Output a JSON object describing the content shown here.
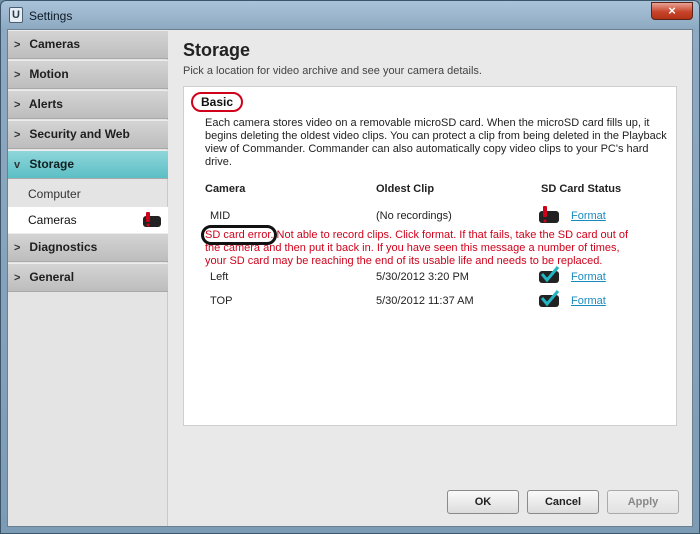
{
  "window": {
    "title": "Settings",
    "close_glyph": "×"
  },
  "sidebar": {
    "items": [
      {
        "label": "Cameras",
        "chevron": ">",
        "active": false
      },
      {
        "label": "Motion",
        "chevron": ">",
        "active": false
      },
      {
        "label": "Alerts",
        "chevron": ">",
        "active": false
      },
      {
        "label": "Security and Web",
        "chevron": ">",
        "active": false
      },
      {
        "label": "Storage",
        "chevron": "v",
        "active": true
      },
      {
        "label": "Diagnostics",
        "chevron": ">",
        "active": false
      },
      {
        "label": "General",
        "chevron": ">",
        "active": false
      }
    ],
    "storage_subitems": [
      {
        "label": "Computer",
        "selected": false
      },
      {
        "label": "Cameras",
        "selected": true,
        "status": "error"
      }
    ]
  },
  "main": {
    "title": "Storage",
    "subtitle": "Pick a location for video archive and see your camera details.",
    "basic_label": "Basic",
    "description": "Each camera stores video on a removable microSD card. When the microSD card fills up, it begins deleting the oldest video clips. You can protect a clip from being deleted in the Playback view of Commander. Commander can also automatically copy video clips to your PC's hard drive.",
    "table": {
      "headers": [
        "Camera",
        "Oldest Clip",
        "SD Card Status"
      ],
      "rows": [
        {
          "camera": "MID",
          "oldest_clip": "(No recordings)",
          "status": "error",
          "action": "Format"
        },
        {
          "camera": "Left",
          "oldest_clip": "5/30/2012 3:20 PM",
          "status": "ok",
          "action": "Format"
        },
        {
          "camera": "TOP",
          "oldest_clip": "5/30/2012 11:37 AM",
          "status": "ok",
          "action": "Format"
        }
      ]
    },
    "error_message": "SD card error. Not able to record clips. Click format. If that fails, take the SD card out of the camera and then put it back in. If you have seen this message a number of times, your SD card may be reaching the end of its usable life and needs to be replaced."
  },
  "footer": {
    "ok": "OK",
    "cancel": "Cancel",
    "apply": "Apply"
  },
  "colors": {
    "accent_active": "#5bbfc5",
    "error_red": "#d0021b",
    "link": "#1a8bbf",
    "ok_check": "#21b5c3"
  }
}
